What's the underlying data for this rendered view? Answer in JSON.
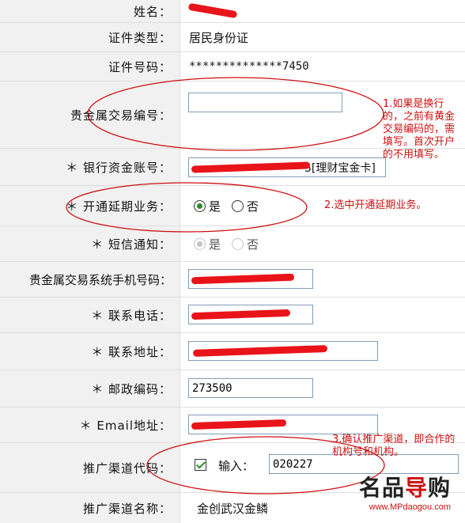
{
  "rows": {
    "name": {
      "label": "姓名："
    },
    "id_type": {
      "label": "证件类型：",
      "value": "居民身份证"
    },
    "id_number": {
      "label": "证件号码：",
      "value": "**************7450"
    },
    "metal_code": {
      "label": "贵金属交易编号：",
      "value": ""
    },
    "bank_account": {
      "label": "＊ 银行资金账号：",
      "suffix": "5[理财宝金卡]"
    },
    "extended": {
      "label": "＊ 开通延期业务：",
      "yes": "是",
      "no": "否",
      "selected": "是"
    },
    "sms": {
      "label": "＊ 短信通知：",
      "yes": "是",
      "no": "否",
      "selected": "是"
    },
    "mobile": {
      "label": "贵金属交易系统手机号码："
    },
    "phone": {
      "label": "＊ 联系电话："
    },
    "address": {
      "label": "＊ 联系地址："
    },
    "postcode": {
      "label": "＊ 邮政编码：",
      "value": "273500"
    },
    "email": {
      "label": "＊ Email地址："
    },
    "channel_code": {
      "label": "推广渠道代码：",
      "input_label": "输入：",
      "value": "020227",
      "checked": true
    },
    "channel_name": {
      "label": "推广渠道名称：",
      "value": "金创武汉金鳞"
    }
  },
  "notes": {
    "note1": "1.如果是换行的，之前有黄金交易编码的，需填写。首次开户的不用填写。",
    "note2": "2.选中开通延期业务。",
    "note3": "3.确认推广渠道，即合作的机构号和机构。"
  },
  "watermark": {
    "brand_a": "名品",
    "brand_b": "导",
    "brand_c": "购",
    "url": "www.MPdaogou.com"
  },
  "colors": {
    "annotation": "#cc1111",
    "label_bg": "#f1f1f1",
    "border": "#dedede"
  }
}
